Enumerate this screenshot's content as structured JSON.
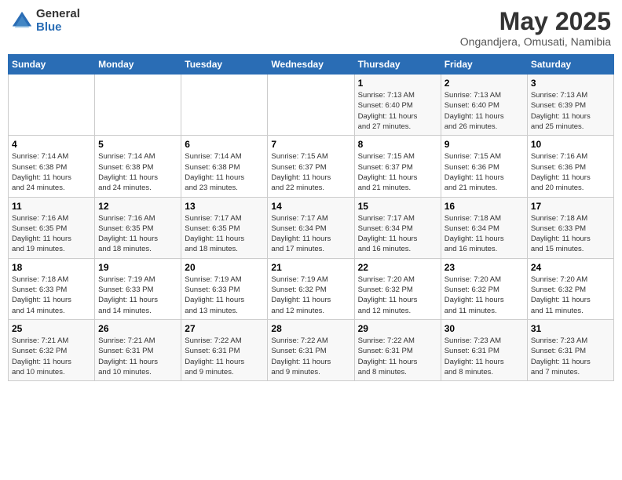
{
  "header": {
    "logo_general": "General",
    "logo_blue": "Blue",
    "month": "May 2025",
    "location": "Ongandjera, Omusati, Namibia"
  },
  "days_of_week": [
    "Sunday",
    "Monday",
    "Tuesday",
    "Wednesday",
    "Thursday",
    "Friday",
    "Saturday"
  ],
  "weeks": [
    [
      {
        "day": "",
        "info": ""
      },
      {
        "day": "",
        "info": ""
      },
      {
        "day": "",
        "info": ""
      },
      {
        "day": "",
        "info": ""
      },
      {
        "day": "1",
        "info": "Sunrise: 7:13 AM\nSunset: 6:40 PM\nDaylight: 11 hours\nand 27 minutes."
      },
      {
        "day": "2",
        "info": "Sunrise: 7:13 AM\nSunset: 6:40 PM\nDaylight: 11 hours\nand 26 minutes."
      },
      {
        "day": "3",
        "info": "Sunrise: 7:13 AM\nSunset: 6:39 PM\nDaylight: 11 hours\nand 25 minutes."
      }
    ],
    [
      {
        "day": "4",
        "info": "Sunrise: 7:14 AM\nSunset: 6:38 PM\nDaylight: 11 hours\nand 24 minutes."
      },
      {
        "day": "5",
        "info": "Sunrise: 7:14 AM\nSunset: 6:38 PM\nDaylight: 11 hours\nand 24 minutes."
      },
      {
        "day": "6",
        "info": "Sunrise: 7:14 AM\nSunset: 6:38 PM\nDaylight: 11 hours\nand 23 minutes."
      },
      {
        "day": "7",
        "info": "Sunrise: 7:15 AM\nSunset: 6:37 PM\nDaylight: 11 hours\nand 22 minutes."
      },
      {
        "day": "8",
        "info": "Sunrise: 7:15 AM\nSunset: 6:37 PM\nDaylight: 11 hours\nand 21 minutes."
      },
      {
        "day": "9",
        "info": "Sunrise: 7:15 AM\nSunset: 6:36 PM\nDaylight: 11 hours\nand 21 minutes."
      },
      {
        "day": "10",
        "info": "Sunrise: 7:16 AM\nSunset: 6:36 PM\nDaylight: 11 hours\nand 20 minutes."
      }
    ],
    [
      {
        "day": "11",
        "info": "Sunrise: 7:16 AM\nSunset: 6:35 PM\nDaylight: 11 hours\nand 19 minutes."
      },
      {
        "day": "12",
        "info": "Sunrise: 7:16 AM\nSunset: 6:35 PM\nDaylight: 11 hours\nand 18 minutes."
      },
      {
        "day": "13",
        "info": "Sunrise: 7:17 AM\nSunset: 6:35 PM\nDaylight: 11 hours\nand 18 minutes."
      },
      {
        "day": "14",
        "info": "Sunrise: 7:17 AM\nSunset: 6:34 PM\nDaylight: 11 hours\nand 17 minutes."
      },
      {
        "day": "15",
        "info": "Sunrise: 7:17 AM\nSunset: 6:34 PM\nDaylight: 11 hours\nand 16 minutes."
      },
      {
        "day": "16",
        "info": "Sunrise: 7:18 AM\nSunset: 6:34 PM\nDaylight: 11 hours\nand 16 minutes."
      },
      {
        "day": "17",
        "info": "Sunrise: 7:18 AM\nSunset: 6:33 PM\nDaylight: 11 hours\nand 15 minutes."
      }
    ],
    [
      {
        "day": "18",
        "info": "Sunrise: 7:18 AM\nSunset: 6:33 PM\nDaylight: 11 hours\nand 14 minutes."
      },
      {
        "day": "19",
        "info": "Sunrise: 7:19 AM\nSunset: 6:33 PM\nDaylight: 11 hours\nand 14 minutes."
      },
      {
        "day": "20",
        "info": "Sunrise: 7:19 AM\nSunset: 6:33 PM\nDaylight: 11 hours\nand 13 minutes."
      },
      {
        "day": "21",
        "info": "Sunrise: 7:19 AM\nSunset: 6:32 PM\nDaylight: 11 hours\nand 12 minutes."
      },
      {
        "day": "22",
        "info": "Sunrise: 7:20 AM\nSunset: 6:32 PM\nDaylight: 11 hours\nand 12 minutes."
      },
      {
        "day": "23",
        "info": "Sunrise: 7:20 AM\nSunset: 6:32 PM\nDaylight: 11 hours\nand 11 minutes."
      },
      {
        "day": "24",
        "info": "Sunrise: 7:20 AM\nSunset: 6:32 PM\nDaylight: 11 hours\nand 11 minutes."
      }
    ],
    [
      {
        "day": "25",
        "info": "Sunrise: 7:21 AM\nSunset: 6:32 PM\nDaylight: 11 hours\nand 10 minutes."
      },
      {
        "day": "26",
        "info": "Sunrise: 7:21 AM\nSunset: 6:31 PM\nDaylight: 11 hours\nand 10 minutes."
      },
      {
        "day": "27",
        "info": "Sunrise: 7:22 AM\nSunset: 6:31 PM\nDaylight: 11 hours\nand 9 minutes."
      },
      {
        "day": "28",
        "info": "Sunrise: 7:22 AM\nSunset: 6:31 PM\nDaylight: 11 hours\nand 9 minutes."
      },
      {
        "day": "29",
        "info": "Sunrise: 7:22 AM\nSunset: 6:31 PM\nDaylight: 11 hours\nand 8 minutes."
      },
      {
        "day": "30",
        "info": "Sunrise: 7:23 AM\nSunset: 6:31 PM\nDaylight: 11 hours\nand 8 minutes."
      },
      {
        "day": "31",
        "info": "Sunrise: 7:23 AM\nSunset: 6:31 PM\nDaylight: 11 hours\nand 7 minutes."
      }
    ]
  ]
}
